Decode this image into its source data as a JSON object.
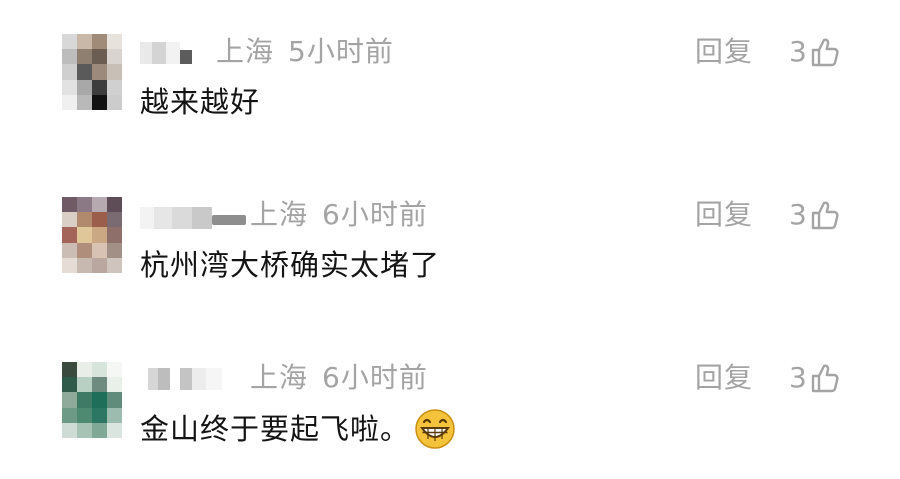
{
  "comments": [
    {
      "location": "上海",
      "time": "5小时前",
      "text": "越来越好",
      "reply_label": "回复",
      "like_count": "3",
      "avatar_colors": [
        "#d8d8d8",
        "#c9b8a8",
        "#a08a78",
        "#e8e2dc",
        "#bdbdbd",
        "#8f7f70",
        "#6b5d52",
        "#d9d4cf",
        "#cfcfcf",
        "#5a5a5a",
        "#9c8b7c",
        "#c8bfb6",
        "#e2e2e2",
        "#a8a8a8",
        "#3d3d3d",
        "#d0d0d0",
        "#f0f0f0",
        "#b9b9b9",
        "#111111",
        "#cccccc"
      ]
    },
    {
      "location": "上海",
      "time": "6小时前",
      "text": "杭州湾大桥确实太堵了",
      "reply_label": "回复",
      "like_count": "3",
      "avatar_colors": [
        "#6f5a66",
        "#8b7a85",
        "#b7a9b0",
        "#5e4c57",
        "#d9cfc6",
        "#b18a6e",
        "#9a5e4a",
        "#7a6a72",
        "#a3655a",
        "#e0c79a",
        "#c9a883",
        "#8e6f6a",
        "#cbbdb3",
        "#b08e7c",
        "#d7c2b4",
        "#a29086",
        "#e6dcd6",
        "#c7b8b0",
        "#b9a7a0",
        "#d0c4be"
      ]
    },
    {
      "location": "上海",
      "time": "6小时前",
      "text": "金山终于要起飞啦。",
      "reply_label": "回复",
      "like_count": "3",
      "avatar_colors": [
        "#3b4a3e",
        "#e9eee8",
        "#d7e4dc",
        "#f4f7f4",
        "#2f5a49",
        "#b8cfc4",
        "#6f8a7e",
        "#e9efe9",
        "#8fa99b",
        "#3f7a66",
        "#1f6e5a",
        "#5f8c7b",
        "#6d9a86",
        "#4e8a72",
        "#2c7763",
        "#9bbcae",
        "#cfdcd5",
        "#a7c3b6",
        "#7fa896",
        "#d9e5de"
      ]
    }
  ],
  "icons": {
    "like": "thumbs-up-icon",
    "emoji": "grin-emoji-icon"
  },
  "colors": {
    "meta_text": "#a4a4a4",
    "body_text": "#141414",
    "emoji_face": "#f5c33b"
  }
}
